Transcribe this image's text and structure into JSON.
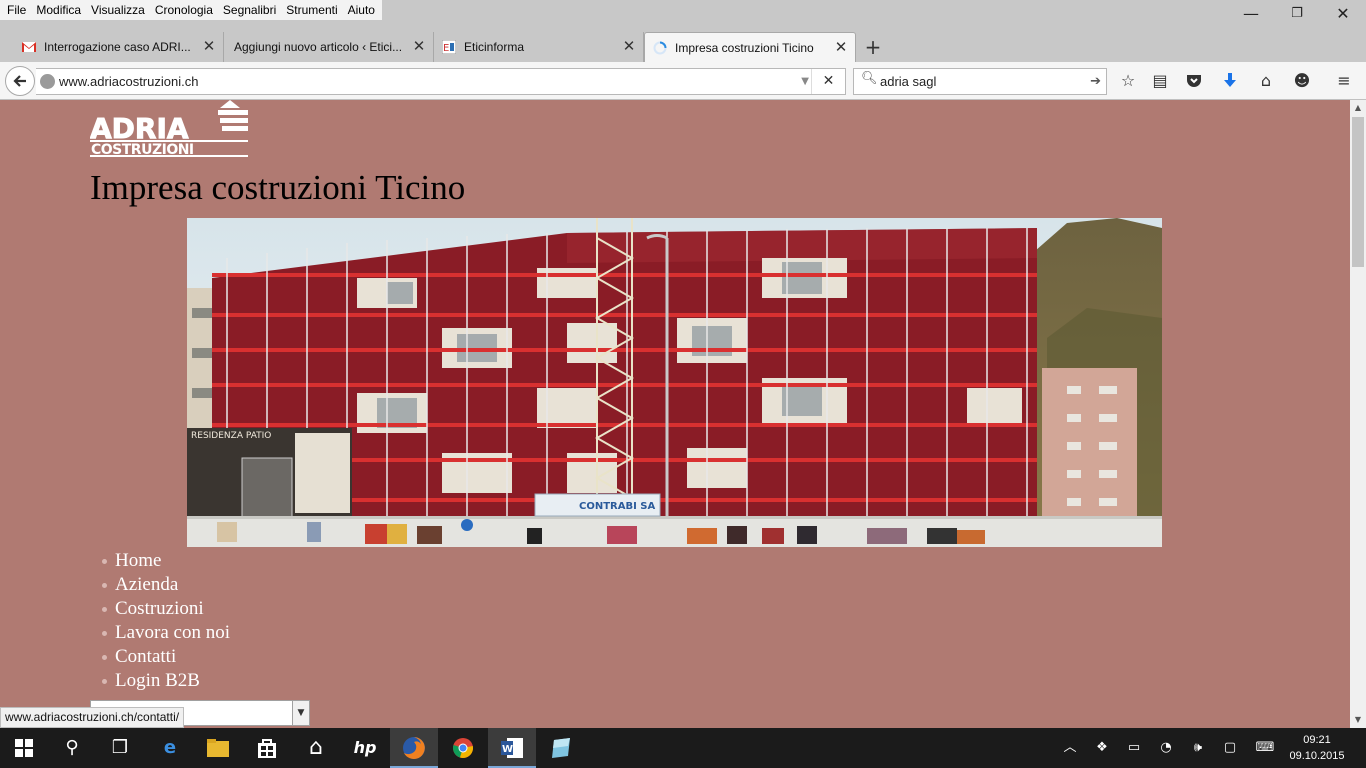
{
  "menubar": {
    "items": [
      "File",
      "Modifica",
      "Visualizza",
      "Cronologia",
      "Segnalibri",
      "Strumenti",
      "Aiuto"
    ],
    "minimize": "—",
    "restore": "❐",
    "close": "✕"
  },
  "tabs": [
    {
      "label": "Interrogazione caso ADRI...",
      "icon": "gmail-icon",
      "active": false
    },
    {
      "label": "Aggiungi nuovo articolo ‹ Etici...",
      "icon": "wordpress-icon",
      "active": false
    },
    {
      "label": "Eticinforma",
      "icon": "eticinforma-icon",
      "active": false
    },
    {
      "label": "Impresa costruzioni Ticino",
      "icon": "loading-icon",
      "active": true
    }
  ],
  "navbar": {
    "url": "www.adriacostruzioni.ch",
    "search_value": "adria sagl"
  },
  "page": {
    "logo_top": "ADRIA",
    "logo_bottom": "COSTRUZIONI",
    "title": "Impresa costruzioni Ticino",
    "hero_sign": "RESIDENZA PATIO",
    "hero_company": "CONTRABI SA",
    "nav": [
      "Home",
      "Azienda",
      "Costruzioni",
      "Lavora con noi",
      "Contatti",
      "Login B2B"
    ]
  },
  "status": {
    "link": "www.adriacostruzioni.ch/contatti/"
  },
  "taskbar": {
    "time": "09:21",
    "date": "09.10.2015"
  },
  "colors": {
    "page_bg": "#b07a72",
    "building_red": "#8a1c26"
  }
}
